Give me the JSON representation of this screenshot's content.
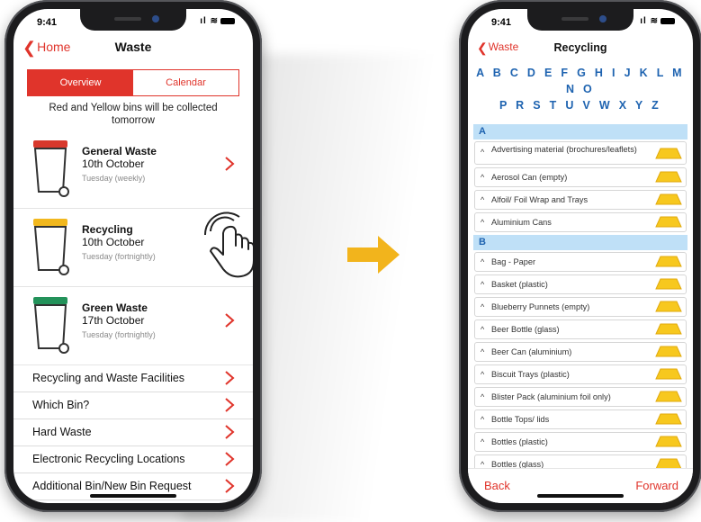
{
  "status_bar": {
    "time": "9:41",
    "signal_icons": "signal-wifi"
  },
  "phone1": {
    "nav": {
      "back_label": "Home",
      "title": "Waste"
    },
    "tabs": [
      {
        "label": "Overview",
        "active": true
      },
      {
        "label": "Calendar",
        "active": false
      }
    ],
    "notice": "Red and Yellow bins will be collected tomorrow",
    "bins": [
      {
        "name": "General Waste",
        "date": "10th October",
        "frequency": "Tuesday (weekly)",
        "lid_color": "#d8382c"
      },
      {
        "name": "Recycling",
        "date": "10th October",
        "frequency": "Tuesday (fortnightly)",
        "lid_color": "#f2b81e"
      },
      {
        "name": "Green Waste",
        "date": "17th October",
        "frequency": "Tuesday (fortnightly)",
        "lid_color": "#23925a"
      }
    ],
    "links": [
      "Recycling and Waste Facilities",
      "Which Bin?",
      "Hard Waste",
      "Electronic Recycling Locations",
      "Additional Bin/New Bin Request"
    ]
  },
  "phone2": {
    "nav": {
      "back_label": "Waste",
      "title": "Recycling"
    },
    "alphabet_line1": "A B C D E F G H I J K L M N O",
    "alphabet_line2": "P R S T U V W X Y Z",
    "sections": [
      {
        "letter": "A",
        "items": [
          "Advertising material (brochures/leaflets)",
          "Aerosol Can (empty)",
          "Alfoil/ Foil Wrap and Trays",
          "Aluminium Cans"
        ]
      },
      {
        "letter": "B",
        "items": [
          "Bag - Paper",
          "Basket (plastic)",
          "Blueberry Punnets (empty)",
          "Beer Bottle (glass)",
          "Beer Can (aluminium)",
          "Biscuit Trays (plastic)",
          "Blister Pack (aluminium foil only)",
          "Bottle Tops/ lids",
          "Bottles (plastic)",
          "Bottles (glass)"
        ]
      }
    ],
    "bottom_bar": {
      "back_label": "Back",
      "forward_label": "Forward"
    }
  },
  "colors": {
    "accent_red": "#e0342b",
    "link_blue": "#1e63b0",
    "section_bg": "#bfe0f7",
    "arrow_yellow": "#f2b41c",
    "bin_yellow": "#f7c81e"
  }
}
